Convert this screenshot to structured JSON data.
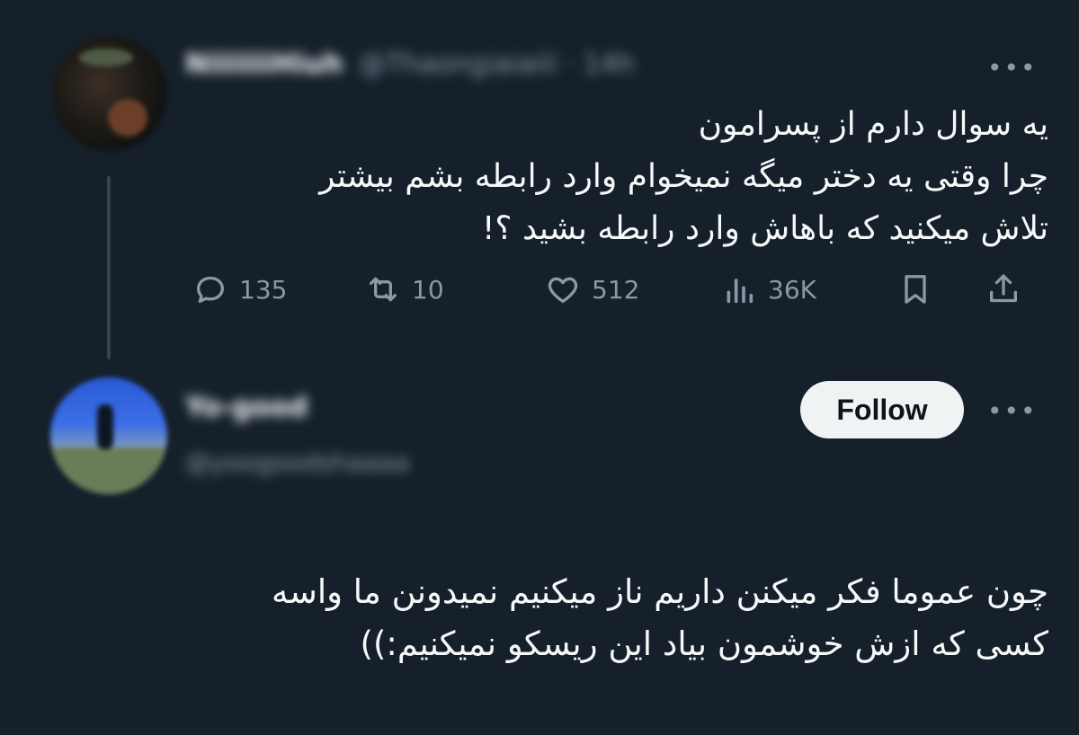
{
  "tweet": {
    "author_name": "NiiiiiiiHiuh",
    "author_handle": "@Thaongiaiaiii · 14h",
    "text_lines": [
      "یه سوال دارم از پسرامون",
      "چرا وقتی یه دختر میگه نمیخوام وارد رابطه بشم بیشتر",
      "تلاش میکنید که باهاش وارد رابطه بشید ؟!"
    ],
    "stats": {
      "replies": "135",
      "retweets": "10",
      "likes": "512",
      "views": "36K"
    }
  },
  "reply": {
    "author_name": "Yo-good",
    "author_handle": "@yoogoodshaaaa",
    "follow_label": "Follow",
    "text_lines": [
      "چون عموما فکر میکنن داریم ناز میکنیم نمیدونن ما واسه",
      "کسی که ازش خوشمون بیاد این ریسکو نمیکنیم:))"
    ]
  },
  "icons": {
    "more": "more-dots-icon",
    "reply": "reply-icon",
    "retweet": "retweet-icon",
    "like": "heart-icon",
    "views": "views-icon",
    "bookmark": "bookmark-icon",
    "share": "share-icon"
  },
  "colors": {
    "background": "#15202b",
    "text": "#f7f9f9",
    "secondary": "#8b98a5",
    "button_bg": "#eff3f4"
  }
}
